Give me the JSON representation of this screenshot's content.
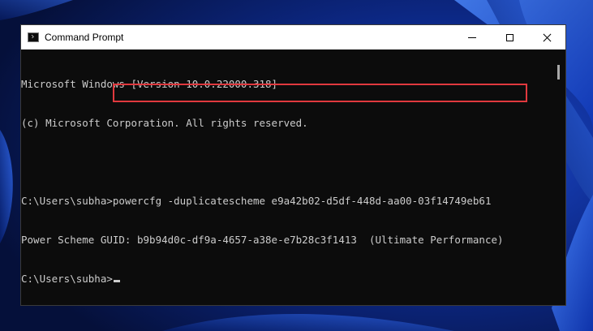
{
  "window": {
    "title": "Command Prompt",
    "icon": "cmd-icon"
  },
  "console": {
    "lines": [
      "Microsoft Windows [Version 10.0.22000.318]",
      "(c) Microsoft Corporation. All rights reserved.",
      "",
      "C:\\Users\\subha>",
      "Power Scheme GUID: b9b94d0c-df9a-4657-a38e-e7b28c3f1413  (Ultimate Performance)",
      "C:\\Users\\subha>"
    ],
    "typed_command": "powercfg -duplicatescheme e9a42b02-d5df-448d-aa00-03f14749eb61"
  },
  "colors": {
    "console_bg": "#0c0c0c",
    "console_text": "#cccccc",
    "highlight": "#e0393e",
    "titlebar": "#ffffff"
  }
}
